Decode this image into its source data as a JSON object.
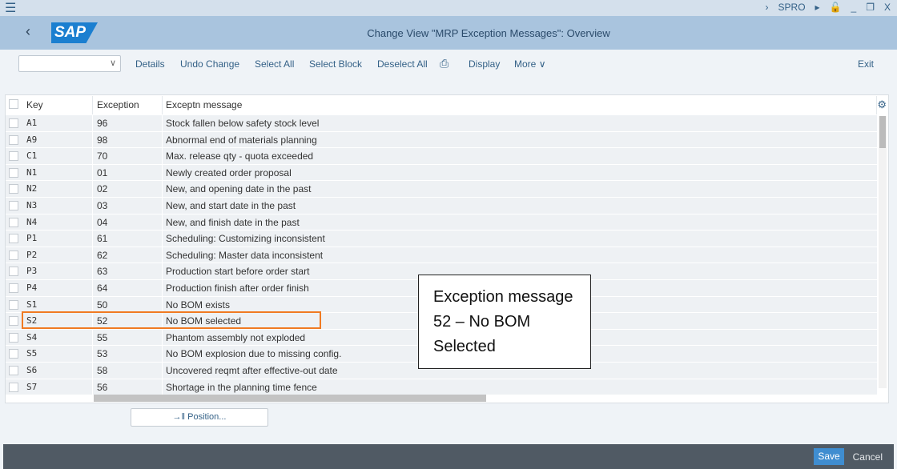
{
  "topbar": {
    "menu_icon": "hamburger-icon",
    "tcode": "SPRO"
  },
  "header": {
    "title": "Change View \"MRP Exception Messages\": Overview",
    "logo": "SAP"
  },
  "toolbar": {
    "details": "Details",
    "undo": "Undo Change",
    "select_all": "Select All",
    "select_block": "Select Block",
    "deselect_all": "Deselect All",
    "display": "Display",
    "more": "More",
    "exit": "Exit",
    "dropdown_value": ""
  },
  "table": {
    "columns": [
      "Key",
      "Exception",
      "Exceptn message"
    ],
    "rows": [
      [
        "A1",
        "96",
        "Stock fallen below safety stock level"
      ],
      [
        "A9",
        "98",
        "Abnormal end of materials planning"
      ],
      [
        "C1",
        "70",
        "Max. release qty - quota exceeded"
      ],
      [
        "N1",
        "01",
        "Newly created order proposal"
      ],
      [
        "N2",
        "02",
        "New, and opening date in the past"
      ],
      [
        "N3",
        "03",
        "New, and start date in the past"
      ],
      [
        "N4",
        "04",
        "New, and finish date in the past"
      ],
      [
        "P1",
        "61",
        "Scheduling: Customizing inconsistent"
      ],
      [
        "P2",
        "62",
        "Scheduling: Master data inconsistent"
      ],
      [
        "P3",
        "63",
        "Production start before order start"
      ],
      [
        "P4",
        "64",
        "Production finish after order finish"
      ],
      [
        "S1",
        "50",
        "No BOM exists"
      ],
      [
        "S2",
        "52",
        "No BOM selected"
      ],
      [
        "S4",
        "55",
        "Phantom assembly not exploded"
      ],
      [
        "S5",
        "53",
        "No BOM explosion due to missing config."
      ],
      [
        "S6",
        "58",
        "Uncovered reqmt after effective-out date"
      ],
      [
        "S7",
        "56",
        "Shortage in the planning time fence"
      ]
    ],
    "highlighted_key": "S2",
    "highlight_color": "#f07a22"
  },
  "annotation": "Exception message 52 – No BOM Selected",
  "position_button": "Position...",
  "footer": {
    "save": "Save",
    "cancel": "Cancel"
  }
}
